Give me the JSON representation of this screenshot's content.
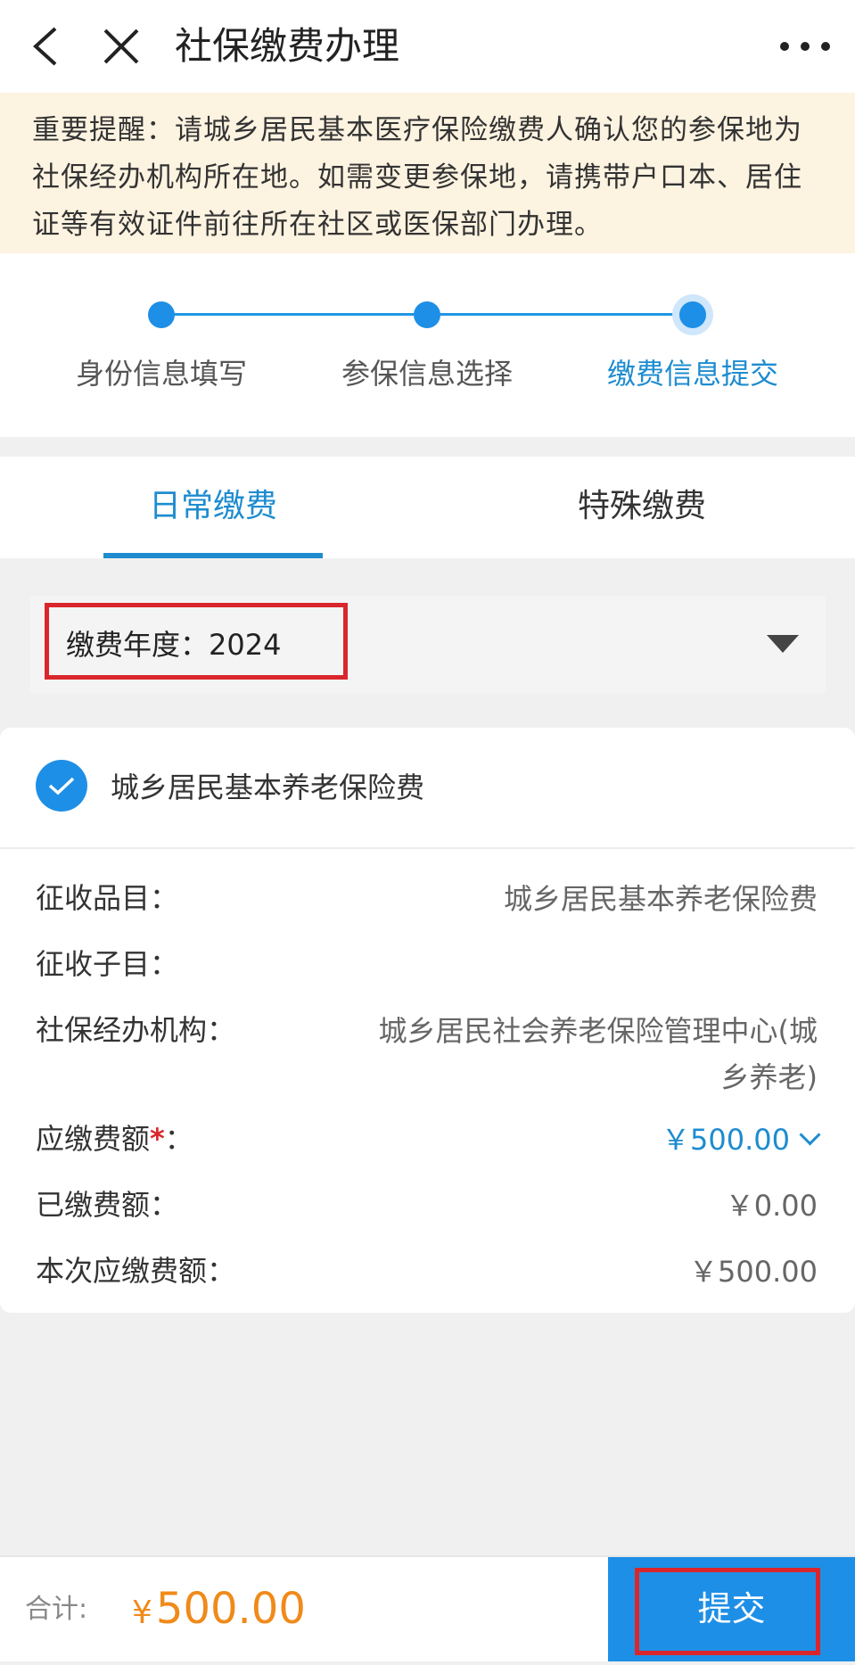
{
  "header": {
    "title": "社保缴费办理"
  },
  "notice": {
    "text": "重要提醒：请城乡居民基本医疗保险缴费人确认您的参保地为社保经办机构所在地。如需变更参保地，请携带户口本、居住证等有效证件前往所在社区或医保部门办理。"
  },
  "steps": [
    {
      "label": "身份信息填写"
    },
    {
      "label": "参保信息选择"
    },
    {
      "label": "缴费信息提交"
    }
  ],
  "tabs": [
    {
      "label": "日常缴费"
    },
    {
      "label": "特殊缴费"
    }
  ],
  "year_select": {
    "label": "缴费年度：",
    "value": "2024"
  },
  "item": {
    "name": "城乡居民基本养老保险费"
  },
  "details": {
    "category_label": "征收品目：",
    "category_value": "城乡居民基本养老保险费",
    "subcategory_label": "征收子目：",
    "subcategory_value": "",
    "agency_label": "社保经办机构：",
    "agency_value": "城乡居民社会养老保险管理中心(城乡养老)",
    "due_label": "应缴费额",
    "due_suffix": "：",
    "due_value": "￥500.00",
    "paid_label": "已缴费额：",
    "paid_value": "￥0.00",
    "current_label": "本次应缴费额：",
    "current_value": "￥500.00"
  },
  "footer": {
    "total_label": "合计:",
    "currency": "¥",
    "total_value": "500.00",
    "submit_label": "提交"
  },
  "colors": {
    "accent": "#1e8fe6",
    "highlight_box": "#d9262c",
    "total": "#f08a1a",
    "notice_bg": "#fdf3e1"
  }
}
